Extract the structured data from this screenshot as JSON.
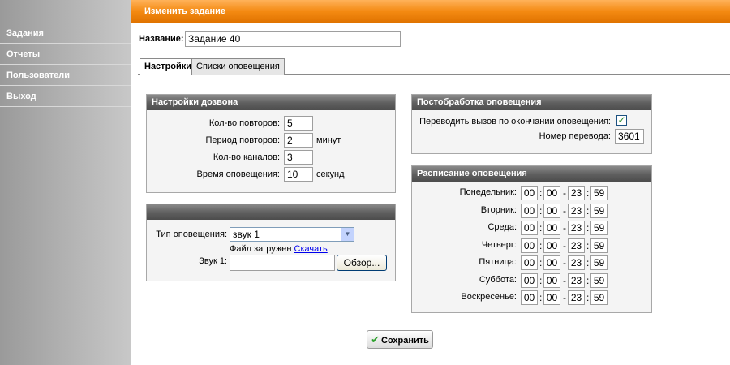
{
  "sidebar": {
    "items": [
      {
        "label": "Задания"
      },
      {
        "label": "Отчеты"
      },
      {
        "label": "Пользователи"
      },
      {
        "label": "Выход"
      }
    ]
  },
  "header": {
    "title": "Изменить задание"
  },
  "form": {
    "name_label": "Название:",
    "name_value": "Задание 40"
  },
  "tabs": [
    {
      "label": "Настройки",
      "active": true
    },
    {
      "label": "Списки оповещения",
      "active": false
    }
  ],
  "dial_settings": {
    "title": "Настройки дозвона",
    "retries_label": "Кол-во повторов:",
    "retries_value": "5",
    "period_label": "Период повторов:",
    "period_value": "2",
    "period_unit": "минут",
    "channels_label": "Кол-во каналов:",
    "channels_value": "3",
    "time_label": "Время оповещения:",
    "time_value": "10",
    "time_unit": "секунд"
  },
  "sound_panel": {
    "type_label": "Тип оповещения:",
    "type_value": "звук 1",
    "loaded_text": "Файл загружен",
    "download_link": "Скачать",
    "sound_label": "Звук 1:",
    "file_value": "",
    "browse_label": "Обзор..."
  },
  "post_processing": {
    "title": "Постобработка оповещения",
    "transfer_label": "Переводить вызов по окончании оповещения:",
    "transfer_checked": true,
    "number_label": "Номер перевода:",
    "number_value": "3601"
  },
  "schedule": {
    "title": "Расписание оповещения",
    "days": [
      {
        "day": "Понедельник:",
        "from_h": "00",
        "from_m": "00",
        "to_h": "23",
        "to_m": "59"
      },
      {
        "day": "Вторник:",
        "from_h": "00",
        "from_m": "00",
        "to_h": "23",
        "to_m": "59"
      },
      {
        "day": "Среда:",
        "from_h": "00",
        "from_m": "00",
        "to_h": "23",
        "to_m": "59"
      },
      {
        "day": "Четверг:",
        "from_h": "00",
        "from_m": "00",
        "to_h": "23",
        "to_m": "59"
      },
      {
        "day": "Пятница:",
        "from_h": "00",
        "from_m": "00",
        "to_h": "23",
        "to_m": "59"
      },
      {
        "day": "Суббота:",
        "from_h": "00",
        "from_m": "00",
        "to_h": "23",
        "to_m": "59"
      },
      {
        "day": "Воскресенье:",
        "from_h": "00",
        "from_m": "00",
        "to_h": "23",
        "to_m": "59"
      }
    ],
    "dash": "-",
    "colon": ":"
  },
  "actions": {
    "save_label": "Сохранить",
    "save_icon": "check-icon"
  },
  "colors": {
    "header_orange": "#f48a12",
    "panel_header": "#5e5e5e",
    "sidebar_gray": "#b4b4b4"
  }
}
